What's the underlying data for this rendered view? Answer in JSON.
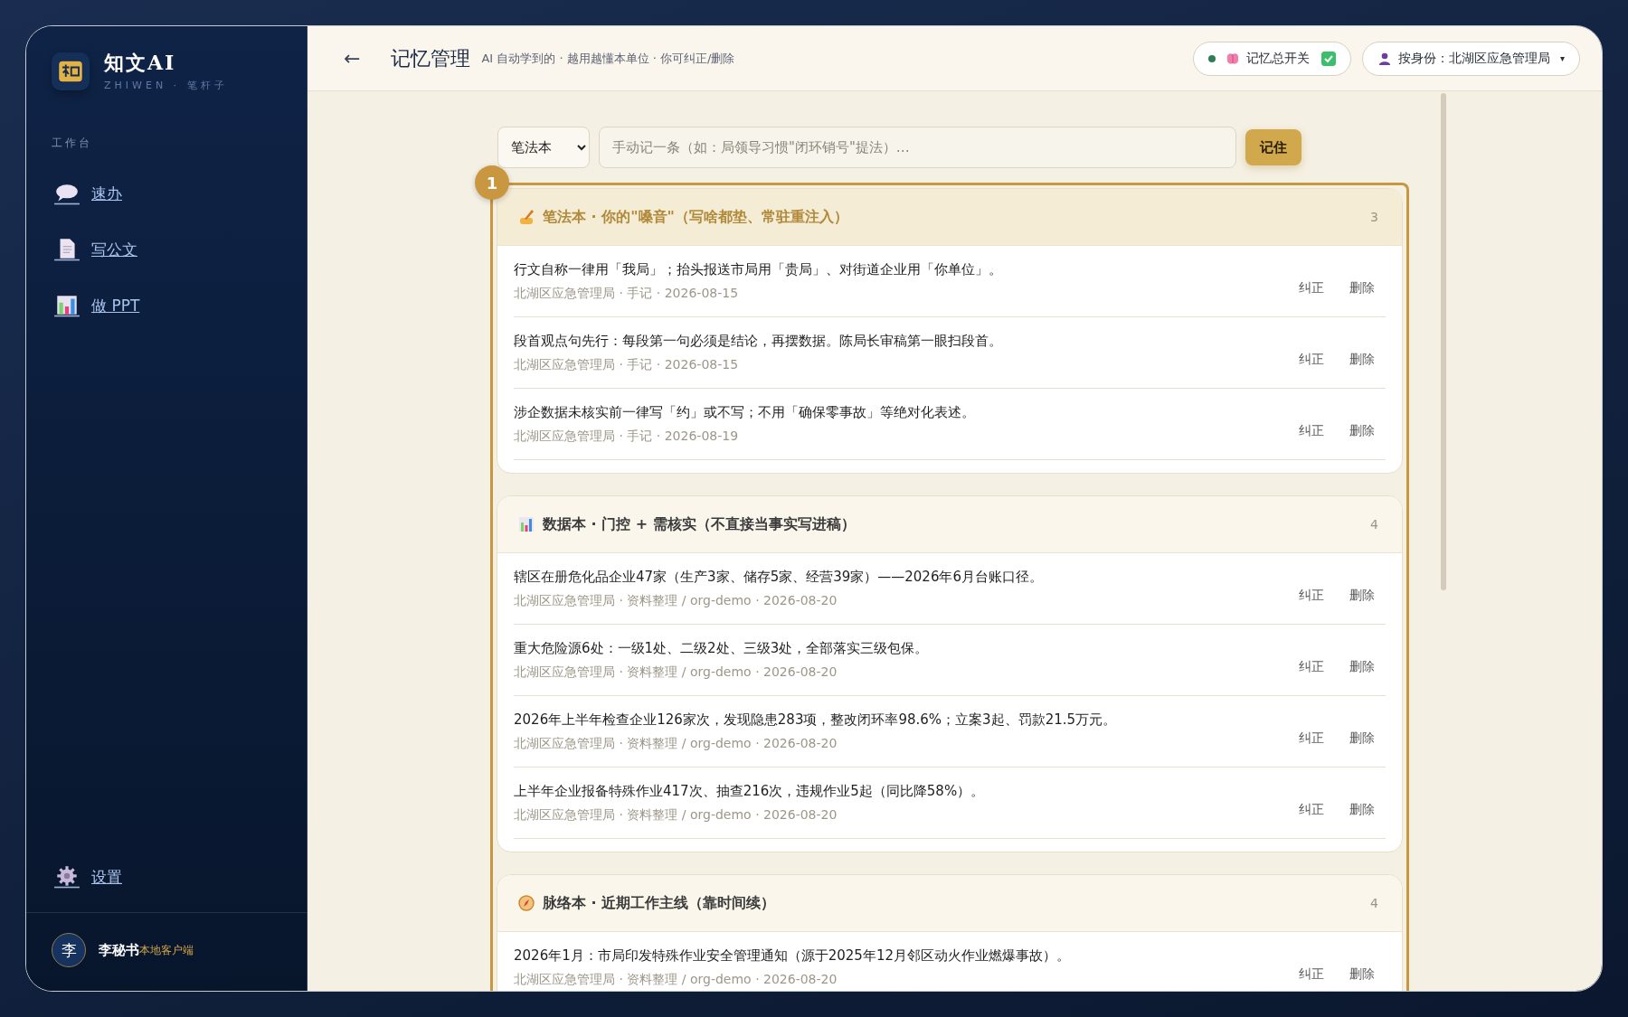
{
  "brand": {
    "name": "知文AI",
    "subtitle": "ZHIWEN · 笔杆子"
  },
  "sidebar": {
    "section_label": "工作台",
    "items": [
      {
        "label": "速办",
        "kind": "chat"
      },
      {
        "label": "写公文",
        "kind": "document"
      },
      {
        "label": "做 PPT",
        "kind": "chart"
      }
    ],
    "footer_items": [
      {
        "label": "设置",
        "kind": "gear"
      }
    ],
    "user": {
      "avatar": "李",
      "name": "李秘书",
      "tag": "本地客户端"
    }
  },
  "header": {
    "back": "←",
    "title": "记忆管理",
    "subtitle": "AI 自动学到的 · 越用越懂本单位 · 你可纠正/删除",
    "memory_switch": {
      "label": "记忆总开关",
      "checked": true
    },
    "identity": {
      "label": "按身份：北湖区应急管理局",
      "caret": "▾"
    }
  },
  "composer": {
    "category": "笔法本",
    "placeholder": "手动记一条（如：局领导习惯\"闭环销号\"提法）…",
    "button": "记住"
  },
  "highlight": {
    "step": "1"
  },
  "groups": [
    {
      "kind": "writing",
      "title": "笔法本 · 你的\"嗓音\"（写啥都垫、常驻重注入）",
      "count": "3",
      "selected": true,
      "items": [
        {
          "text": "行文自称一律用「我局」；抬头报送市局用「贵局」、对街道企业用「你单位」。",
          "meta": "北湖区应急管理局 · 手记 · 2026-08-15",
          "actions": [
            "纠正",
            "删除"
          ]
        },
        {
          "text": "段首观点句先行：每段第一句必须是结论，再摆数据。陈局长审稿第一眼扫段首。",
          "meta": "北湖区应急管理局 · 手记 · 2026-08-15",
          "actions": [
            "纠正",
            "删除"
          ]
        },
        {
          "text": "涉企数据未核实前一律写「约」或不写；不用「确保零事故」等绝对化表述。",
          "meta": "北湖区应急管理局 · 手记 · 2026-08-19",
          "actions": [
            "纠正",
            "删除"
          ]
        }
      ]
    },
    {
      "kind": "chart",
      "title": "数据本 · 门控 + 需核实（不直接当事实写进稿）",
      "count": "4",
      "selected": false,
      "items": [
        {
          "text": "辖区在册危化品企业47家（生产3家、储存5家、经营39家）——2026年6月台账口径。",
          "meta": "北湖区应急管理局 · 资料整理 / org-demo · 2026-08-20",
          "actions": [
            "纠正",
            "删除"
          ]
        },
        {
          "text": "重大危险源6处：一级1处、二级2处、三级3处，全部落实三级包保。",
          "meta": "北湖区应急管理局 · 资料整理 / org-demo · 2026-08-20",
          "actions": [
            "纠正",
            "删除"
          ]
        },
        {
          "text": "2026年上半年检查企业126家次，发现隐患283项，整改闭环率98.6%；立案3起、罚款21.5万元。",
          "meta": "北湖区应急管理局 · 资料整理 / org-demo · 2026-08-20",
          "actions": [
            "纠正",
            "删除"
          ]
        },
        {
          "text": "上半年企业报备特殊作业417次、抽查216次，违规作业5起（同比降58%）。",
          "meta": "北湖区应急管理局 · 资料整理 / org-demo · 2026-08-20",
          "actions": [
            "纠正",
            "删除"
          ]
        }
      ]
    },
    {
      "kind": "compass",
      "title": "脉络本 · 近期工作主线（靠时间续）",
      "count": "4",
      "selected": false,
      "items": [
        {
          "text": "2026年1月：市局印发特殊作业安全管理通知（源于2025年12月邻区动火作业燃爆事故）。",
          "meta": "北湖区应急管理局 · 资料整理 / org-demo · 2026-08-20",
          "actions": [
            "纠正",
            "删除"
          ]
        }
      ]
    }
  ]
}
